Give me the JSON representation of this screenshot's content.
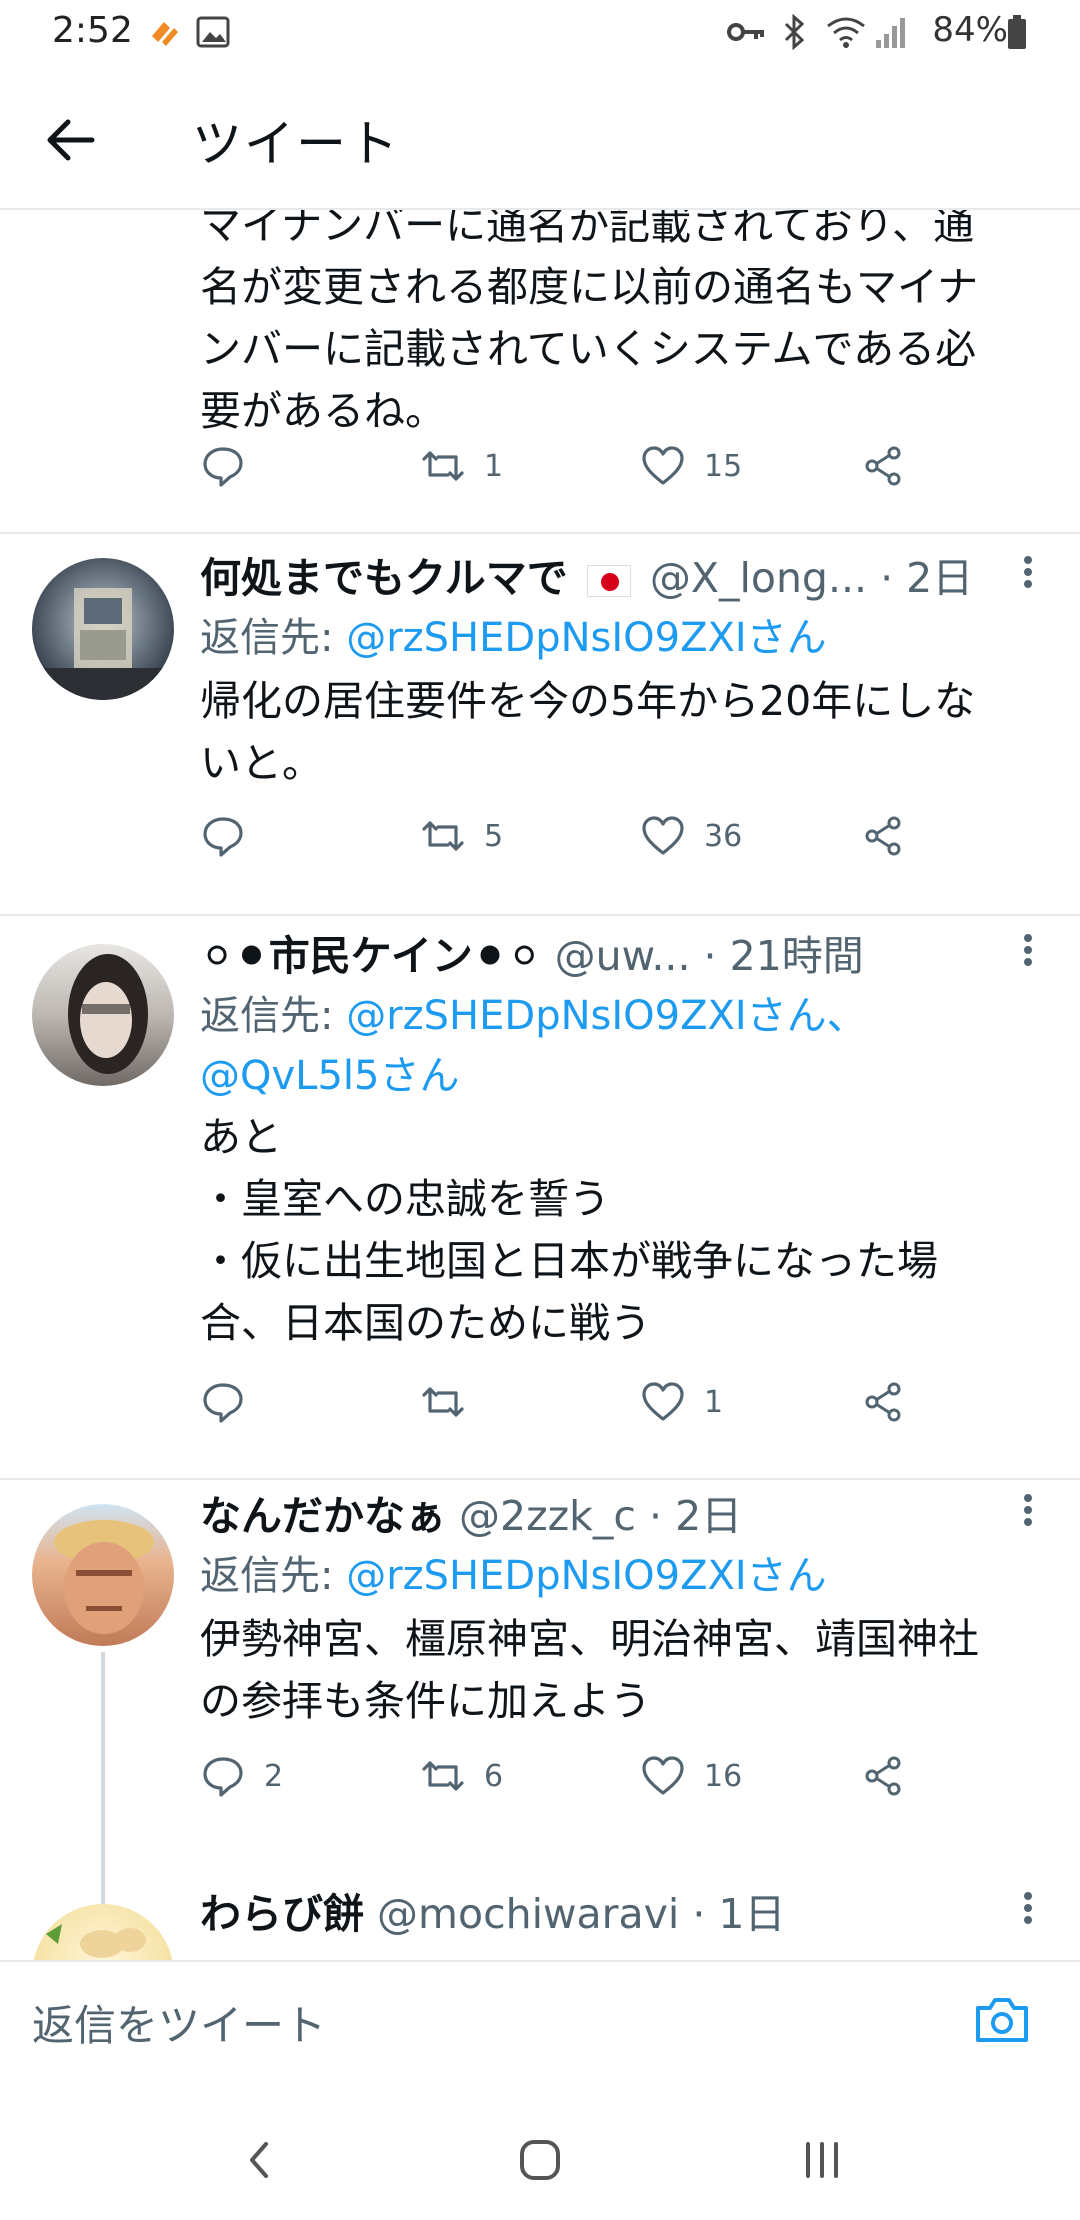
{
  "status_bar": {
    "time": "2:52",
    "battery": "84%",
    "icons": [
      "notification-icon",
      "gallery-icon",
      "key-icon",
      "bluetooth-icon",
      "wifi-icon",
      "signal-icon",
      "battery-icon"
    ]
  },
  "header": {
    "title": "ツイート",
    "back_icon": "arrow-left-icon"
  },
  "tweets": [
    {
      "text": "マイナンバーに通名か記載されており、通\n名が変更される都度に以前の通名もマイナ\nンバーに記載されていくシステムである必\n要があるね。",
      "replies": "",
      "retweets": "1",
      "likes": "15"
    },
    {
      "name": "何処までもクルマで",
      "handle": "@X_long...",
      "time": "· 2日",
      "reply_label": "返信先: ",
      "reply_to": "@rzSHEDpNsIO9ZXIさん",
      "text": "帰化の居住要件を今の5年から20年にしな\nいと。",
      "replies": "",
      "retweets": "5",
      "likes": "36"
    },
    {
      "name": "⚪⚫市民ケイン⚫⚪",
      "handle": "@uw...",
      "time": "· 21時間",
      "reply_label": "返信先: ",
      "reply_to": "@rzSHEDpNsIO9ZXIさん、",
      "reply_to2": "@QvL5l5さん",
      "text": "あと\n・皇室への忠誠を誓う\n・仮に出生地国と日本が戦争になった場\n合、日本国のために戦う",
      "replies": "",
      "retweets": "",
      "likes": "1"
    },
    {
      "name": "なんだかなぁ",
      "handle": "@2zzk_c",
      "time": "· 2日",
      "reply_label": "返信先: ",
      "reply_to": "@rzSHEDpNsIO9ZXIさん",
      "text": "伊勢神宮、橿原神宮、明治神宮、靖国神社\nの参拝も条件に加えよう",
      "replies": "2",
      "retweets": "6",
      "likes": "16"
    },
    {
      "name": "わらび餅",
      "handle": "@mochiwaravi",
      "time": "· 1日"
    }
  ],
  "composer": {
    "placeholder": "返信をツイート"
  },
  "colors": {
    "link": "#1d9bf0",
    "secondary": "#536471",
    "divider": "#e7e9ea"
  }
}
